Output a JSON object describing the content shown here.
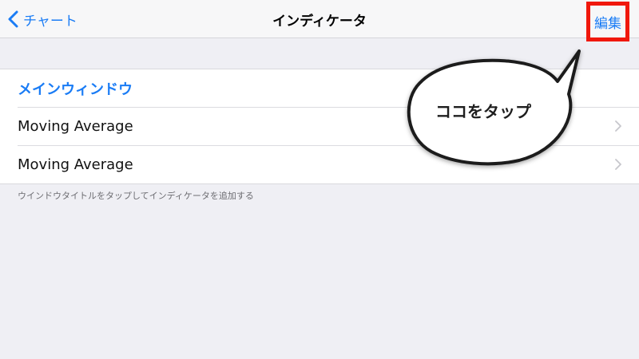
{
  "navbar": {
    "back_label": "チャート",
    "title": "インディケータ",
    "edit_label": "編集"
  },
  "section": {
    "header": "メインウィンドウ",
    "rows": [
      {
        "label": "Moving Average"
      },
      {
        "label": "Moving Average"
      }
    ],
    "footer": "ウインドウタイトルをタップしてインディケータを追加する"
  },
  "callout": {
    "text": "ココをタップ"
  },
  "colors": {
    "accent": "#1a7cf5",
    "highlight": "#f0180c",
    "background": "#efeff4"
  },
  "icons": {
    "back": "chevron-left-icon",
    "disclosure": "chevron-right-icon"
  }
}
